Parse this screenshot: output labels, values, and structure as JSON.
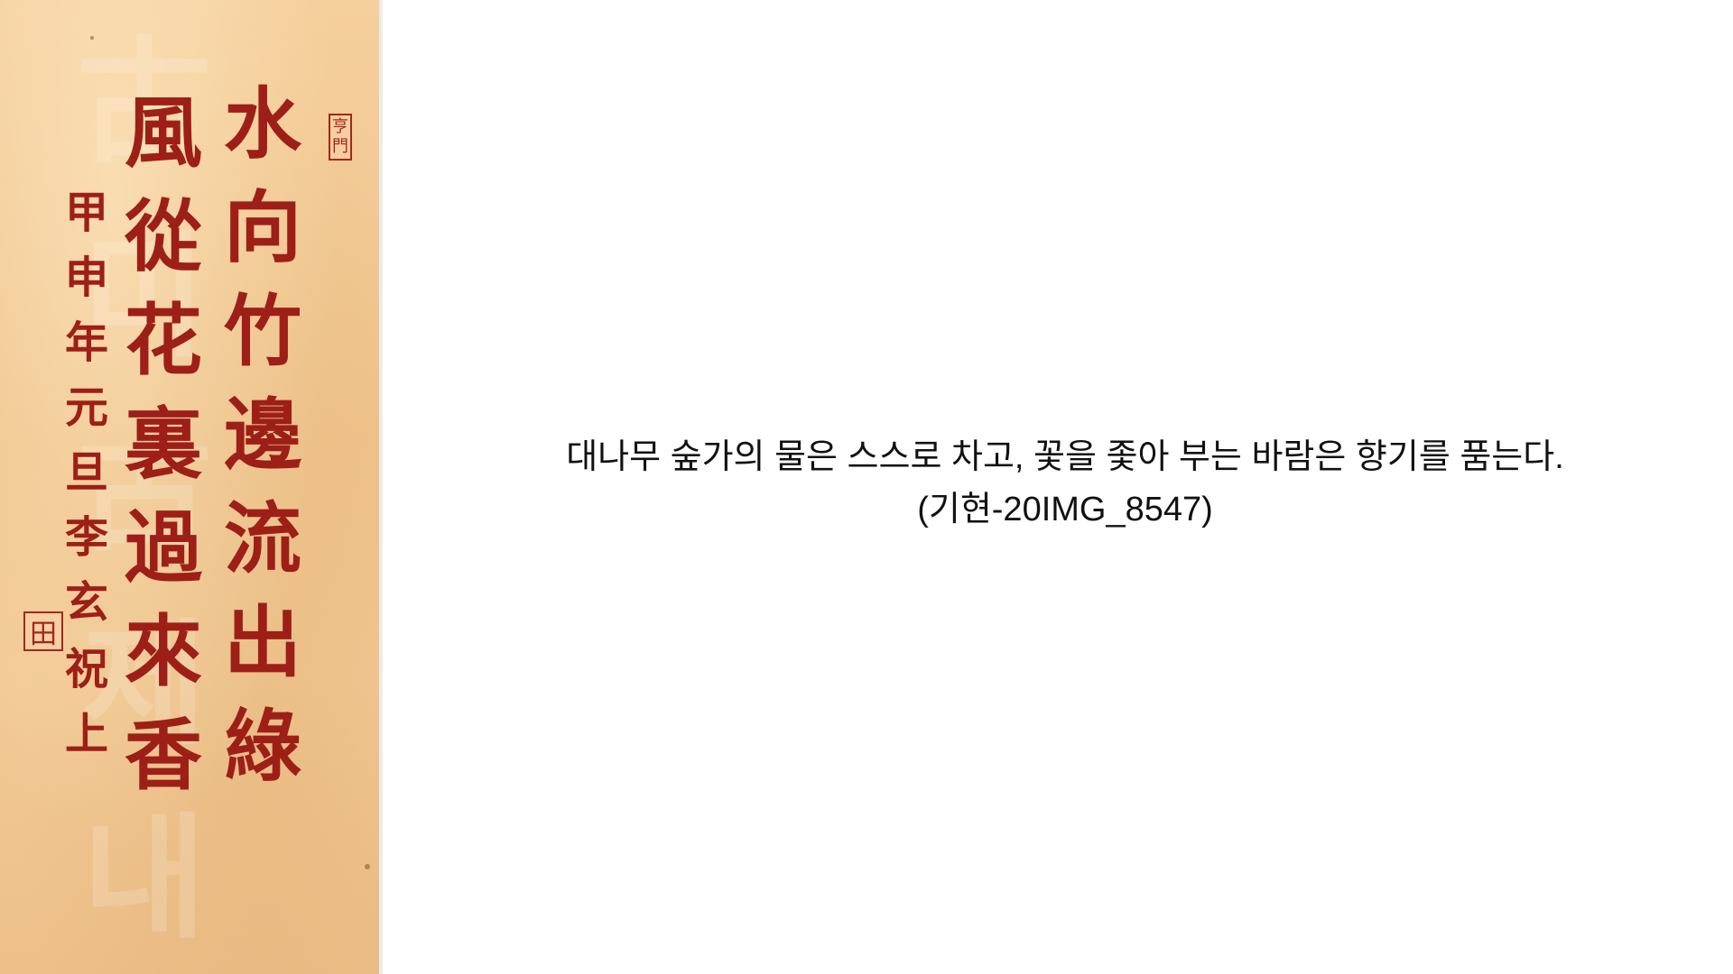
{
  "artwork": {
    "columns": [
      [
        "水",
        "向",
        "竹",
        "邊",
        "流",
        "出",
        "綠"
      ],
      [
        "風",
        "從",
        "花",
        "裏",
        "過",
        "來",
        "香"
      ]
    ],
    "signature": [
      "甲",
      "申",
      "年",
      "元",
      "旦",
      "李",
      "玄"
    ],
    "signature_tail": [
      "祝",
      "上"
    ],
    "seal_top": [
      "亨",
      "門"
    ],
    "seal_bottom": "田",
    "watermark": [
      "古",
      "미",
      "古",
      "제",
      "내"
    ]
  },
  "caption": {
    "line1": "대나무 숲가의 물은 스스로 차고, 꽃을 좇아 부는 바람은 향기를 품는다.",
    "line2": "(기현-20IMG_8547)"
  },
  "colors": {
    "ink": "#9d1f17",
    "paper": "#f2c994",
    "text": "#111111"
  }
}
